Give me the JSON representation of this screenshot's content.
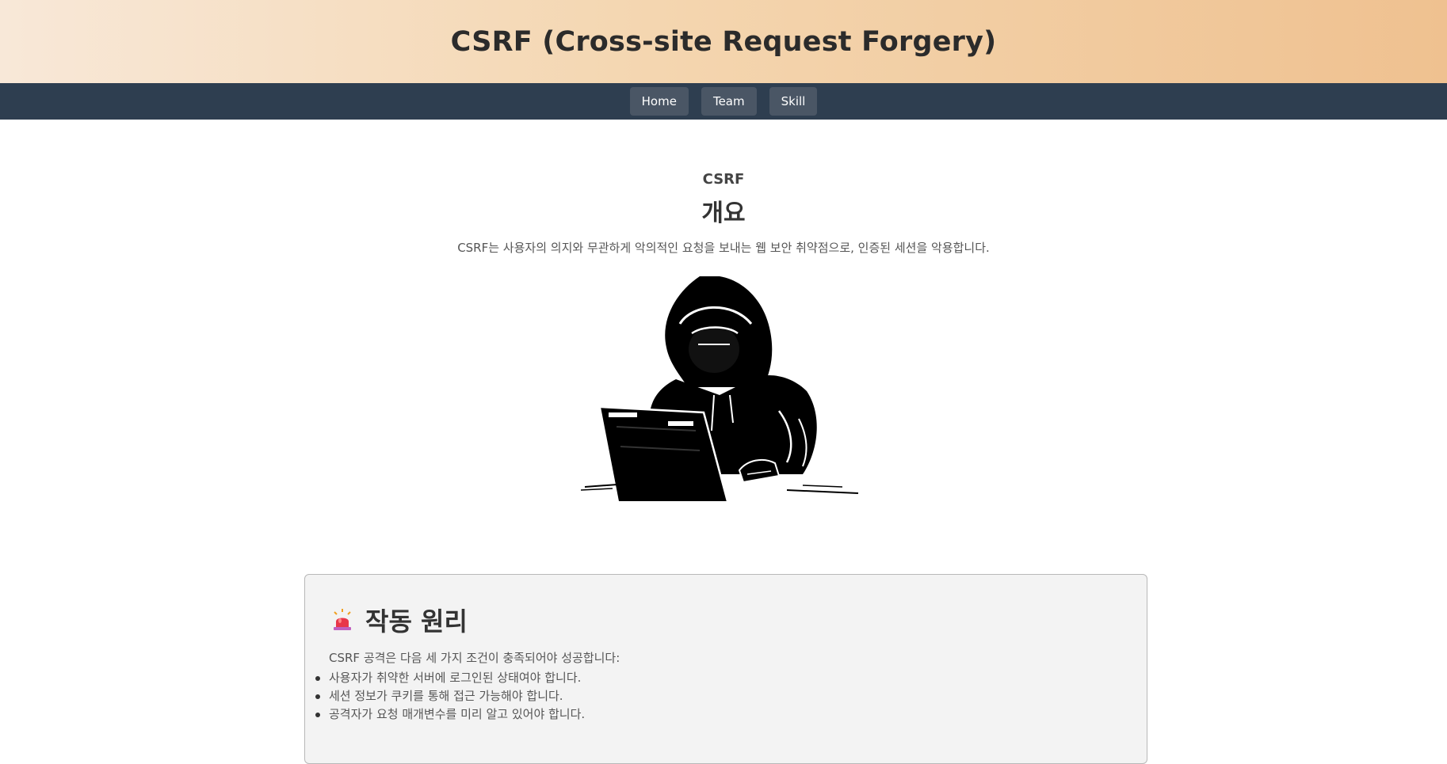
{
  "header": {
    "title": "CSRF (Cross-site Request Forgery)"
  },
  "nav": {
    "items": [
      {
        "label": "Home"
      },
      {
        "label": "Team"
      },
      {
        "label": "Skill"
      }
    ]
  },
  "intro": {
    "eyebrow": "CSRF",
    "headline": "개요",
    "description": "CSRF는 사용자의 의지와 무관하게 악의적인 요청을 보내는 웹 보안 취약점으로, 인증된 세션을 악용합니다.",
    "image_icon": "hooded-hacker-illustration"
  },
  "card": {
    "icon": "siren-icon",
    "title": "작동 원리",
    "intro": "CSRF 공격은 다음 세 가지 조건이 충족되어야 성공합니다:",
    "items": [
      "사용자가 취약한 서버에 로그인된 상태여야 합니다.",
      "세션 정보가 쿠키를 통해 접근 가능해야 합니다.",
      "공격자가 요청 매개변수를 미리 알고 있어야 합니다."
    ]
  },
  "colors": {
    "header_gradient_start": "#f8e8d8",
    "header_gradient_end": "#efc190",
    "navbar": "#2e3e50",
    "nav_button": "#4a5665",
    "card_background": "#f3f3f3"
  }
}
